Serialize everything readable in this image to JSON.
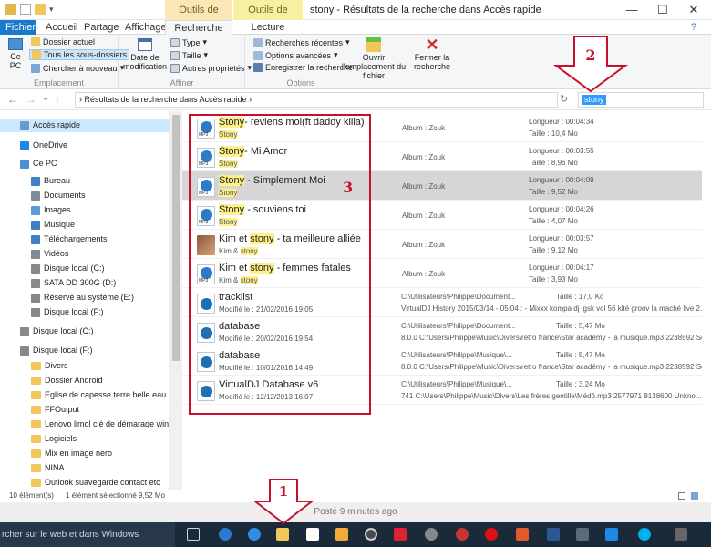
{
  "window": {
    "title": "stony - Résultats de la recherche dans Accès rapide",
    "context_tab_search": "Outils de recherche",
    "context_tab_music": "Outils de musique",
    "minimize": "—",
    "maximize": "☐",
    "close": "✕",
    "help": "?"
  },
  "tabs": {
    "file": "Fichier",
    "home": "Accueil",
    "share": "Partage",
    "view": "Affichage",
    "search": "Recherche",
    "play": "Lecture"
  },
  "ribbon": {
    "location": {
      "group": "Emplacement",
      "this_pc": "Ce PC",
      "current_folder": "Dossier actuel",
      "all_subfolders": "Tous les sous-dossiers",
      "search_again": "Chercher à nouveau"
    },
    "refine": {
      "group": "Affiner",
      "date_modified": "Date de modification",
      "type": "Type",
      "size": "Taille",
      "other_props": "Autres propriétés"
    },
    "options": {
      "group": "Options",
      "recent_searches": "Recherches récentes",
      "advanced_options": "Options avancées",
      "save_search": "Enregistrer la recherche",
      "open_location": "Ouvrir l'emplacement du fichier",
      "close_search": "Fermer la recherche"
    }
  },
  "navbar": {
    "back": "←",
    "forward": "→",
    "recent": "⌄",
    "up": "↑",
    "path": "Résultats de la recherche dans Accès rapide",
    "refresh": "↻",
    "search_value": "stony"
  },
  "sidebar": {
    "items": [
      {
        "label": "Accès rapide",
        "icon": "star-icon"
      },
      {
        "label": "OneDrive",
        "icon": "cloud-icon"
      },
      {
        "label": "Ce PC",
        "icon": "computer-icon"
      },
      {
        "label": "Bureau",
        "icon": "desktop-icon"
      },
      {
        "label": "Documents",
        "icon": "documents-icon"
      },
      {
        "label": "Images",
        "icon": "images-icon"
      },
      {
        "label": "Musique",
        "icon": "music-icon"
      },
      {
        "label": "Téléchargements",
        "icon": "download-icon"
      },
      {
        "label": "Vidéos",
        "icon": "video-icon"
      },
      {
        "label": "Disque local (C:)",
        "icon": "drive-icon"
      },
      {
        "label": "SATA DD 300G (D:)",
        "icon": "drive-icon"
      },
      {
        "label": "Réservé au système (E:)",
        "icon": "drive-icon"
      },
      {
        "label": "Disque local (F:)",
        "icon": "drive-icon"
      },
      {
        "label": "Disque local (C:)",
        "icon": "drive-icon"
      },
      {
        "label": "Disque local (F:)",
        "icon": "drive-icon"
      },
      {
        "label": "Divers",
        "icon": "folder-icon"
      },
      {
        "label": "Dossier Android",
        "icon": "folder-icon"
      },
      {
        "label": "Eglise de capesse terre belle eau",
        "icon": "folder-icon"
      },
      {
        "label": "FFOutput",
        "icon": "folder-icon"
      },
      {
        "label": "Lenovo limol clé de démarage win .81",
        "icon": "folder-icon"
      },
      {
        "label": "Logiciels",
        "icon": "folder-icon"
      },
      {
        "label": "Mix en image nero",
        "icon": "folder-icon"
      },
      {
        "label": "NINA",
        "icon": "folder-icon"
      },
      {
        "label": "Outlook suavegarde contact etc",
        "icon": "folder-icon"
      }
    ]
  },
  "results": [
    {
      "pre": "",
      "hl": "Stony",
      "post": "- reviens moi(ft daddy killa)",
      "sub_hl": "Stony",
      "sub_pre": "",
      "sub_post": "",
      "album": "Album : Zouk",
      "length": "Longueur : 00:04:34",
      "size": "Taille : 10,4 Mo",
      "type": "mp3"
    },
    {
      "pre": "",
      "hl": "Stony",
      "post": "- Mi Amor",
      "sub_hl": "Stony",
      "sub_pre": "",
      "sub_post": "",
      "album": "Album : Zouk",
      "length": "Longueur : 00:03:55",
      "size": "Taille : 8,96 Mo",
      "type": "mp3"
    },
    {
      "pre": "",
      "hl": "Stony",
      "post": " - Simplement Moi",
      "sub_hl": "Stony",
      "sub_pre": "",
      "sub_post": "",
      "album": "Album : Zouk",
      "length": "Longueur : 00:04:09",
      "size": "Taille : 9,52 Mo",
      "type": "mp3"
    },
    {
      "pre": "",
      "hl": "Stony",
      "post": " - souviens toi",
      "sub_hl": "Stony",
      "sub_pre": "",
      "sub_post": "",
      "album": "Album : Zouk",
      "length": "Longueur : 00:04:26",
      "size": "Taille : 4,07 Mo",
      "type": "mp3"
    },
    {
      "pre": "Kim et ",
      "hl": "stony",
      "post": " - ta meilleure alliée",
      "sub_pre": "Kim & ",
      "sub_hl": "stony",
      "sub_post": "",
      "album": "Album : Zouk",
      "length": "Longueur : 00:03:57",
      "size": "Taille : 9,12 Mo",
      "type": "photo"
    },
    {
      "pre": "Kim et ",
      "hl": "stony",
      "post": " - femmes fatales",
      "sub_pre": "Kim & ",
      "sub_hl": "stony",
      "sub_post": "",
      "album": "Album : Zouk",
      "length": "Longueur : 00:04:17",
      "size": "Taille : 3,93 Mo",
      "type": "mp3"
    }
  ],
  "docs": [
    {
      "name": "tracklist",
      "modified": "Modifié le : 21/02/2016 19:05",
      "path": "C:\\Utilisateurs\\Philippe\\Document...",
      "size": "Taille : 17,0 Ko",
      "preview": "VirtualDJ History 2015/03/14 - 05:04 : - Mixxx kompa dj lgsk vol 56 kité groov la maché live 2..."
    },
    {
      "name": "database",
      "modified": "Modifié le : 20/02/2016 19:54",
      "path": "C:\\Utilisateurs\\Philippe\\Document...",
      "size": "Taille : 5,47 Mo",
      "preview": "8.0.0 C:\\Users\\Philippe\\Music\\Divers\\retro france\\Star académy - la musique.mp3 2238592 Se..."
    },
    {
      "name": "database",
      "modified": "Modifié le : 10/01/2016 14:49",
      "path": "C:\\Utilisateurs\\Philippe\\Musique\\...",
      "size": "Taille : 5,47 Mo",
      "preview": "8.0.0 C:\\Users\\Philippe\\Music\\Divers\\retro france\\Star académy - la musique.mp3 2238592 Se..."
    },
    {
      "name": "VirtualDJ Database v6",
      "modified": "Modifié le : 12/12/2013 16:07",
      "path": "C:\\Utilisateurs\\Philippe\\Musique\\...",
      "size": "Taille : 3,24 Mo",
      "preview": "741 C:\\Users\\Philippe\\Music\\Divers\\Les frères gentille\\Médô.mp3 2577971 8138600 Unkno..."
    }
  ],
  "status": {
    "count": "10 élément(s)",
    "selected": "1 élément sélectionné  9,52 Mo"
  },
  "posted": "Posté 9 minutes ago",
  "taskbar": {
    "search_text": "rcher sur le web et dans Windows"
  },
  "annotations": {
    "one": "1",
    "two": "2",
    "three": "3"
  },
  "colors": {
    "accent": "#1979ca",
    "annotation_red": "#c8102e",
    "highlight": "#fff18a",
    "selection": "#d6d6d6"
  }
}
